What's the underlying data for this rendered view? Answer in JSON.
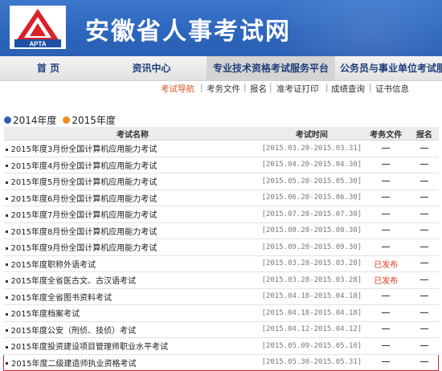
{
  "header": {
    "site_title": "安徽省人事考试网",
    "logo_text": "APTA",
    "brand_color": "#2d66bd"
  },
  "nav": {
    "items": [
      {
        "label": "首  页",
        "active": false
      },
      {
        "label": "资讯中心",
        "active": false
      },
      {
        "label": "专业技术资格考试服务平台",
        "active": true
      },
      {
        "label": "公务员与事业单位考试服务",
        "active": false
      }
    ]
  },
  "subnav": {
    "items": [
      "考试导航",
      "考务文件",
      "报名",
      "准考证打印",
      "成绩查询",
      "证书信息"
    ],
    "active_index": 0,
    "accent_color": "#d9531e"
  },
  "year_tabs": [
    {
      "label": "2014年度",
      "color": "#2f5fb8"
    },
    {
      "label": "2015年度",
      "color": "#f28a1c"
    }
  ],
  "table": {
    "headers": [
      "考试名称",
      "考试时间",
      "考务文件",
      "报名"
    ],
    "rows": [
      {
        "name": "2015年度3月份全国计算机应用能力考试",
        "time": "[2015.03.20-2015.03.31]",
        "file": "",
        "sign": ""
      },
      {
        "name": "2015年度4月份全国计算机应用能力考试",
        "time": "[2015.04.20-2015.04.30]",
        "file": "",
        "sign": ""
      },
      {
        "name": "2015年度5月份全国计算机应用能力考试",
        "time": "[2015.05.20-2015.05.30]",
        "file": "",
        "sign": ""
      },
      {
        "name": "2015年度6月份全国计算机应用能力考试",
        "time": "[2015.06.20-2015.06.30]",
        "file": "",
        "sign": ""
      },
      {
        "name": "2015年度7月份全国计算机应用能力考试",
        "time": "[2015.07.20-2015.07.30]",
        "file": "",
        "sign": ""
      },
      {
        "name": "2015年度8月份全国计算机应用能力考试",
        "time": "[2015.08.20-2015.08.30]",
        "file": "",
        "sign": ""
      },
      {
        "name": "2015年度9月份全国计算机应用能力考试",
        "time": "[2015.09.20-2015.09.30]",
        "file": "",
        "sign": ""
      },
      {
        "name": "2015年度职称外语考试",
        "time": "[2015.03.28-2015.03.28]",
        "file": "已发布",
        "sign": ""
      },
      {
        "name": "2015年度全省医古文、古汉语考试",
        "time": "[2015.03.28-2015.03.28]",
        "file": "已发布",
        "sign": ""
      },
      {
        "name": "2015年度全省图书资料考试",
        "time": "[2015.04.18-2015.04.18]",
        "file": "",
        "sign": ""
      },
      {
        "name": "2015年度档案考试",
        "time": "[2015.04.18-2015.04.18]",
        "file": "",
        "sign": ""
      },
      {
        "name": "2015年度公安（刑侦、技侦）考试",
        "time": "[2015.04.12-2015.04.12]",
        "file": "",
        "sign": ""
      },
      {
        "name": "2015年度投资建设项目管理师职业水平考试",
        "time": "[2015.05.09-2015.05.10]",
        "file": "",
        "sign": ""
      },
      {
        "name": "2015年度二级建造师执业资格考试",
        "time": "[2015.05.30-2015.05.31]",
        "file": "",
        "sign": "",
        "highlighted": true
      }
    ]
  }
}
